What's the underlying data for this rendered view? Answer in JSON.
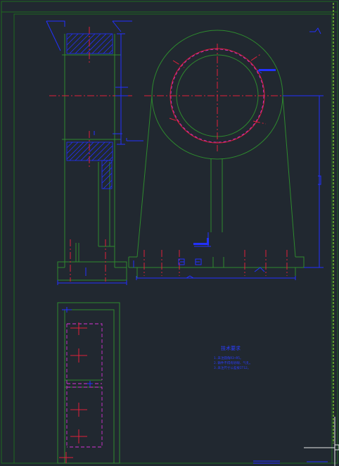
{
  "drawing": {
    "background": "#212830",
    "colors": {
      "frame": "#1f6a1f",
      "outline": "#2e8a2e",
      "dimension": "#2231ff",
      "center_line": "#e0203a",
      "hidden_line": "#d633d6",
      "hatch": "#2231ff",
      "selection": "#e8e8e8",
      "right_guide": "#9bff2a"
    },
    "notes_title": "技术要求",
    "notes": [
      "1.未注圆角R3~R5。",
      "2.铸件不得有砂眼、气孔。",
      "3.未注尺寸公差按IT12。"
    ]
  }
}
